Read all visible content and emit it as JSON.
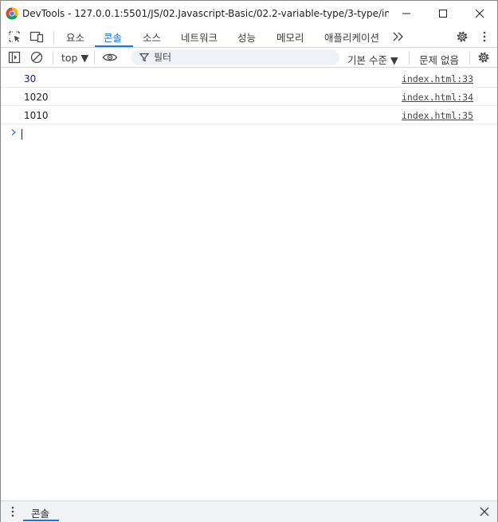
{
  "window": {
    "title": "DevTools - 127.0.0.1:5501/JS/02.Javascript-Basic/02.2-variable-type/3-type/index.ht..."
  },
  "tabs": [
    {
      "label": "요소"
    },
    {
      "label": "콘솔",
      "active": true
    },
    {
      "label": "소스"
    },
    {
      "label": "네트워크"
    },
    {
      "label": "성능"
    },
    {
      "label": "메모리"
    },
    {
      "label": "애플리케이션"
    }
  ],
  "toolbar": {
    "context": "top ▼",
    "filter_placeholder": "필터",
    "levels": "기본 수준 ▼",
    "issues": "문제 없음"
  },
  "console": {
    "messages": [
      {
        "value": "30",
        "link": "index.html:33"
      },
      {
        "value": "1020",
        "link": "index.html:34"
      },
      {
        "value": "1010",
        "link": "index.html:35"
      }
    ]
  },
  "drawer": {
    "tab": "콘솔"
  },
  "icons": {
    "title": [
      "chrome-logo-icon",
      "minimize-icon",
      "maximize-icon",
      "close-icon"
    ],
    "tabbar": [
      "inspect-element-icon",
      "device-toolbar-icon",
      "more-tabs-icon",
      "settings-icon",
      "kebab-menu-icon"
    ],
    "toolbar": [
      "sidebar-toggle-icon",
      "clear-console-icon",
      "eye-icon",
      "filter-icon",
      "console-settings-icon"
    ]
  },
  "colors": {
    "accent": "#1a73e8",
    "number_value": "#1a1aa6",
    "toolbar_bg": "#ffffff",
    "drawer_bg": "#f1f3f4"
  }
}
